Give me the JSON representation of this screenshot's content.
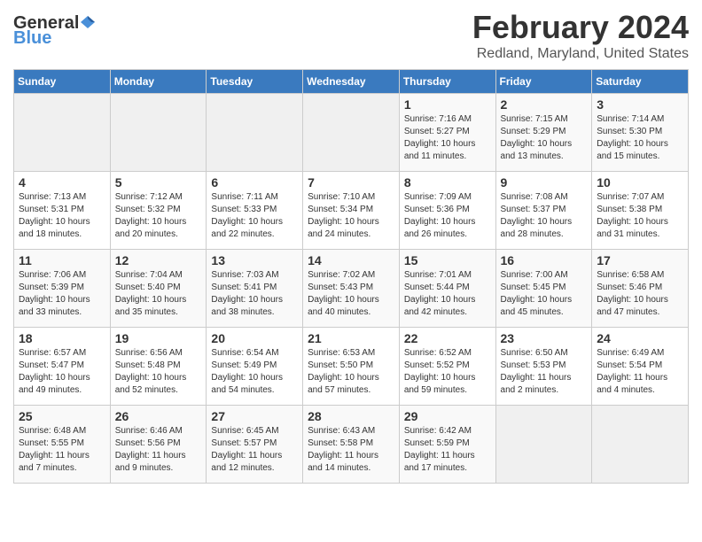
{
  "header": {
    "logo_general": "General",
    "logo_blue": "Blue",
    "month": "February 2024",
    "location": "Redland, Maryland, United States"
  },
  "days_of_week": [
    "Sunday",
    "Monday",
    "Tuesday",
    "Wednesday",
    "Thursday",
    "Friday",
    "Saturday"
  ],
  "weeks": [
    [
      {
        "day": "",
        "info": ""
      },
      {
        "day": "",
        "info": ""
      },
      {
        "day": "",
        "info": ""
      },
      {
        "day": "",
        "info": ""
      },
      {
        "day": "1",
        "info": "Sunrise: 7:16 AM\nSunset: 5:27 PM\nDaylight: 10 hours\nand 11 minutes."
      },
      {
        "day": "2",
        "info": "Sunrise: 7:15 AM\nSunset: 5:29 PM\nDaylight: 10 hours\nand 13 minutes."
      },
      {
        "day": "3",
        "info": "Sunrise: 7:14 AM\nSunset: 5:30 PM\nDaylight: 10 hours\nand 15 minutes."
      }
    ],
    [
      {
        "day": "4",
        "info": "Sunrise: 7:13 AM\nSunset: 5:31 PM\nDaylight: 10 hours\nand 18 minutes."
      },
      {
        "day": "5",
        "info": "Sunrise: 7:12 AM\nSunset: 5:32 PM\nDaylight: 10 hours\nand 20 minutes."
      },
      {
        "day": "6",
        "info": "Sunrise: 7:11 AM\nSunset: 5:33 PM\nDaylight: 10 hours\nand 22 minutes."
      },
      {
        "day": "7",
        "info": "Sunrise: 7:10 AM\nSunset: 5:34 PM\nDaylight: 10 hours\nand 24 minutes."
      },
      {
        "day": "8",
        "info": "Sunrise: 7:09 AM\nSunset: 5:36 PM\nDaylight: 10 hours\nand 26 minutes."
      },
      {
        "day": "9",
        "info": "Sunrise: 7:08 AM\nSunset: 5:37 PM\nDaylight: 10 hours\nand 28 minutes."
      },
      {
        "day": "10",
        "info": "Sunrise: 7:07 AM\nSunset: 5:38 PM\nDaylight: 10 hours\nand 31 minutes."
      }
    ],
    [
      {
        "day": "11",
        "info": "Sunrise: 7:06 AM\nSunset: 5:39 PM\nDaylight: 10 hours\nand 33 minutes."
      },
      {
        "day": "12",
        "info": "Sunrise: 7:04 AM\nSunset: 5:40 PM\nDaylight: 10 hours\nand 35 minutes."
      },
      {
        "day": "13",
        "info": "Sunrise: 7:03 AM\nSunset: 5:41 PM\nDaylight: 10 hours\nand 38 minutes."
      },
      {
        "day": "14",
        "info": "Sunrise: 7:02 AM\nSunset: 5:43 PM\nDaylight: 10 hours\nand 40 minutes."
      },
      {
        "day": "15",
        "info": "Sunrise: 7:01 AM\nSunset: 5:44 PM\nDaylight: 10 hours\nand 42 minutes."
      },
      {
        "day": "16",
        "info": "Sunrise: 7:00 AM\nSunset: 5:45 PM\nDaylight: 10 hours\nand 45 minutes."
      },
      {
        "day": "17",
        "info": "Sunrise: 6:58 AM\nSunset: 5:46 PM\nDaylight: 10 hours\nand 47 minutes."
      }
    ],
    [
      {
        "day": "18",
        "info": "Sunrise: 6:57 AM\nSunset: 5:47 PM\nDaylight: 10 hours\nand 49 minutes."
      },
      {
        "day": "19",
        "info": "Sunrise: 6:56 AM\nSunset: 5:48 PM\nDaylight: 10 hours\nand 52 minutes."
      },
      {
        "day": "20",
        "info": "Sunrise: 6:54 AM\nSunset: 5:49 PM\nDaylight: 10 hours\nand 54 minutes."
      },
      {
        "day": "21",
        "info": "Sunrise: 6:53 AM\nSunset: 5:50 PM\nDaylight: 10 hours\nand 57 minutes."
      },
      {
        "day": "22",
        "info": "Sunrise: 6:52 AM\nSunset: 5:52 PM\nDaylight: 10 hours\nand 59 minutes."
      },
      {
        "day": "23",
        "info": "Sunrise: 6:50 AM\nSunset: 5:53 PM\nDaylight: 11 hours\nand 2 minutes."
      },
      {
        "day": "24",
        "info": "Sunrise: 6:49 AM\nSunset: 5:54 PM\nDaylight: 11 hours\nand 4 minutes."
      }
    ],
    [
      {
        "day": "25",
        "info": "Sunrise: 6:48 AM\nSunset: 5:55 PM\nDaylight: 11 hours\nand 7 minutes."
      },
      {
        "day": "26",
        "info": "Sunrise: 6:46 AM\nSunset: 5:56 PM\nDaylight: 11 hours\nand 9 minutes."
      },
      {
        "day": "27",
        "info": "Sunrise: 6:45 AM\nSunset: 5:57 PM\nDaylight: 11 hours\nand 12 minutes."
      },
      {
        "day": "28",
        "info": "Sunrise: 6:43 AM\nSunset: 5:58 PM\nDaylight: 11 hours\nand 14 minutes."
      },
      {
        "day": "29",
        "info": "Sunrise: 6:42 AM\nSunset: 5:59 PM\nDaylight: 11 hours\nand 17 minutes."
      },
      {
        "day": "",
        "info": ""
      },
      {
        "day": "",
        "info": ""
      }
    ]
  ]
}
